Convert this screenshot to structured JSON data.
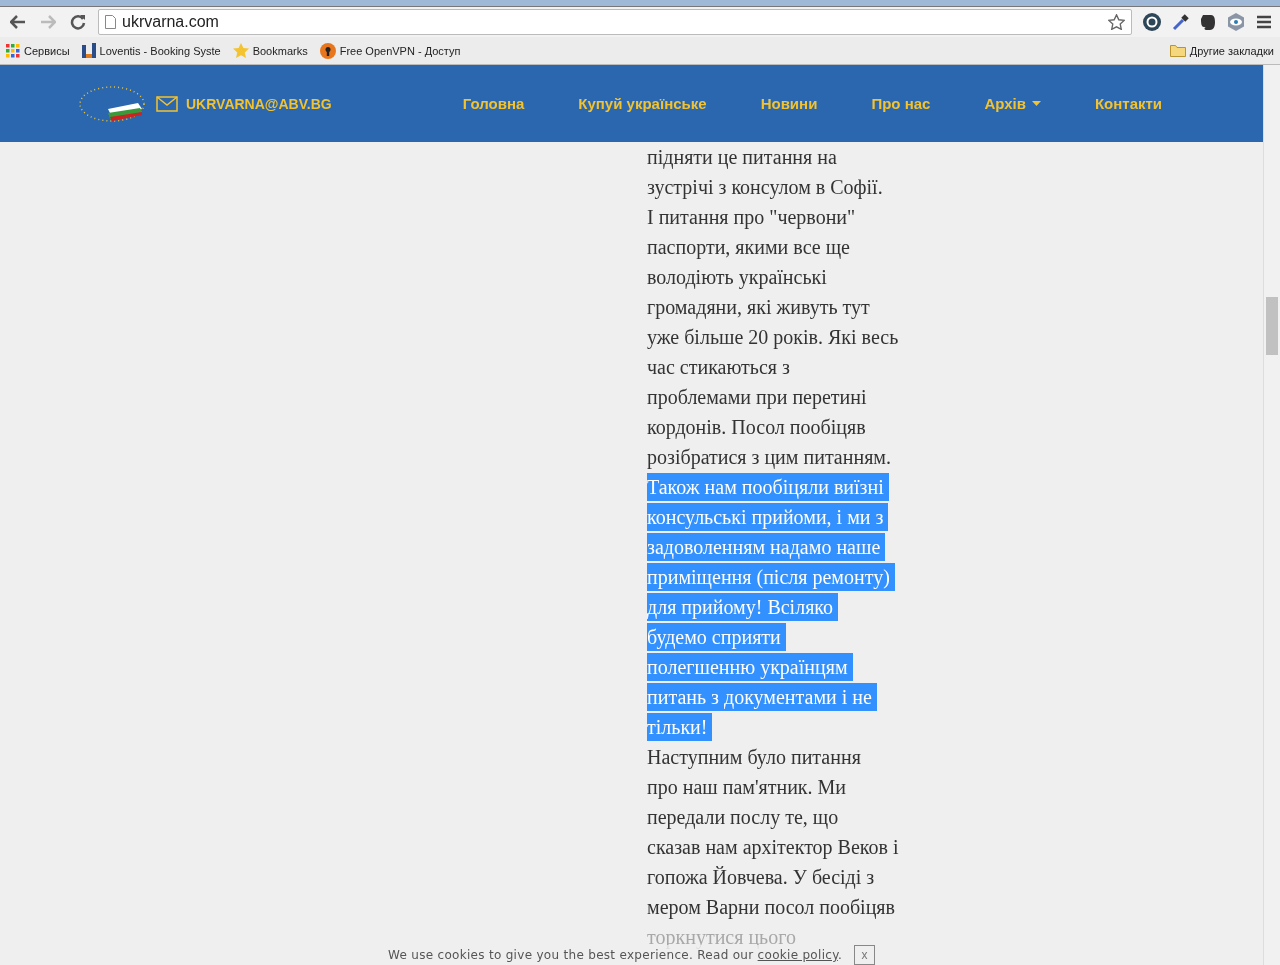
{
  "browser": {
    "url": "ukrvarna.com",
    "bookmarks": [
      {
        "kind": "apps",
        "label": "Сервисы"
      },
      {
        "kind": "site",
        "label": "Loventis - Booking Syste"
      },
      {
        "kind": "star",
        "label": "Bookmarks"
      },
      {
        "kind": "vpn",
        "label": "Free OpenVPN - Доступ"
      }
    ],
    "other_bookmarks": "Другие закладки"
  },
  "site": {
    "email": "UKRVARNA@ABV.BG",
    "nav": [
      {
        "label": "Головна",
        "dropdown": false
      },
      {
        "label": "Купуй українське",
        "dropdown": false
      },
      {
        "label": "Новини",
        "dropdown": false
      },
      {
        "label": "Про нас",
        "dropdown": false
      },
      {
        "label": "Архів",
        "dropdown": true
      },
      {
        "label": "Контакти",
        "dropdown": false
      }
    ]
  },
  "article": {
    "lines": [
      {
        "text": "підняти це питання на",
        "selected": false
      },
      {
        "text": "зустрічі з консулом в Софії.",
        "selected": false
      },
      {
        "text": "І питання про \"червони\"",
        "selected": false
      },
      {
        "text": "паспорти, якими все ще",
        "selected": false
      },
      {
        "text": "володіють українські",
        "selected": false
      },
      {
        "text": "громадяни, які живуть тут",
        "selected": false
      },
      {
        "text": "уже більше 20 років. Які весь",
        "selected": false
      },
      {
        "text": "час стикаються з",
        "selected": false
      },
      {
        "text": "проблемами при перетині",
        "selected": false
      },
      {
        "text": "кордонів. Посол пообіцяв",
        "selected": false
      },
      {
        "text": "розібратися з цим питанням.",
        "selected": false
      },
      {
        "text": "Також нам пообіцяли виїзні",
        "selected": true
      },
      {
        "text": "консульські прийоми, і ми з",
        "selected": true
      },
      {
        "text": "задоволенням надамо наше",
        "selected": true
      },
      {
        "text": "приміщення (після ремонту)",
        "selected": true
      },
      {
        "text": "для прийому! Всіляко",
        "selected": true
      },
      {
        "text": "будемо сприяти",
        "selected": true
      },
      {
        "text": "полегшенню українцям",
        "selected": true
      },
      {
        "text": "питань з документами і не",
        "selected": true
      },
      {
        "text": "тільки!",
        "selected": true
      },
      {
        "text": "Наступним було питання",
        "selected": false
      },
      {
        "text": "про наш пам'ятник. Ми",
        "selected": false
      },
      {
        "text": "передали послу те, що",
        "selected": false
      },
      {
        "text": "сказав нам архітектор Веков і",
        "selected": false
      },
      {
        "text": "гопожа Йовчева. У бесіді з",
        "selected": false
      },
      {
        "text": "мером Варни посол пообіцяв",
        "selected": false
      },
      {
        "text": "торкнутися цього",
        "selected": false
      }
    ]
  },
  "cookie_bar": {
    "text": "We use cookies to give you the best experience. Read our ",
    "link": "cookie policy",
    "after": ".",
    "close": "x"
  }
}
